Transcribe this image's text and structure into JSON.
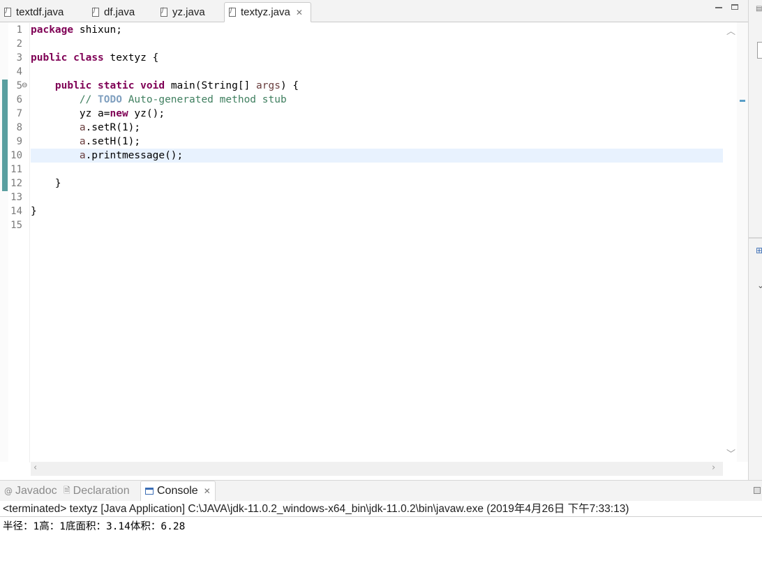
{
  "editor_tabs": [
    {
      "label": "textdf.java",
      "active": false
    },
    {
      "label": "df.java",
      "active": false
    },
    {
      "label": "yz.java",
      "active": false
    },
    {
      "label": "textyz.java",
      "active": true
    }
  ],
  "line_numbers": [
    "1",
    "2",
    "3",
    "4",
    "5",
    "6",
    "7",
    "8",
    "9",
    "10",
    "11",
    "12",
    "13",
    "14",
    "15"
  ],
  "code": {
    "l1_kw": "package",
    "l1_rest": " shixun;",
    "l3_kw1": "public",
    "l3_kw2": "class",
    "l3_rest": " textyz {",
    "l5_indent": "    ",
    "l5_kw1": "public",
    "l5_kw2": "static",
    "l5_kw3": "void",
    "l5_mid": " main(String[] ",
    "l5_var": "args",
    "l5_end": ") {",
    "l6_indent": "        ",
    "l6_c1": "// ",
    "l6_todo": "TODO",
    "l6_c2": " Auto-generated method stub",
    "l7_indent": "        ",
    "l7_a": "yz a=",
    "l7_kw": "new",
    "l7_b": " yz();",
    "l8_indent": "        ",
    "l8_var": "a",
    "l8_rest": ".setR(1);",
    "l9_indent": "        ",
    "l9_var": "a",
    "l9_rest": ".setH(1);",
    "l10_indent": "        ",
    "l10_var": "a",
    "l10_rest": ".printmessage();",
    "l12": "    }",
    "l14": "}"
  },
  "view_tabs": [
    {
      "label": "Javadoc",
      "icon": "at-icon",
      "active": false
    },
    {
      "label": "Declaration",
      "icon": "declaration-icon",
      "active": false
    },
    {
      "label": "Console",
      "icon": "console-icon",
      "active": true
    }
  ],
  "console": {
    "header": "<terminated> textyz [Java Application] C:\\JAVA\\jdk-11.0.2_windows-x64_bin\\jdk-11.0.2\\bin\\javaw.exe (2019年4月26日 下午7:33:13)",
    "output": "半径：1高：1底面积：3.14体积：6.28"
  },
  "colors": {
    "keyword": "#7f0055",
    "comment": "#3f7f5f",
    "todo": "#7f9fbf",
    "local_var": "#6a3e3e",
    "current_line": "#e8f2fe",
    "change_bar": "#5a9fa0"
  }
}
